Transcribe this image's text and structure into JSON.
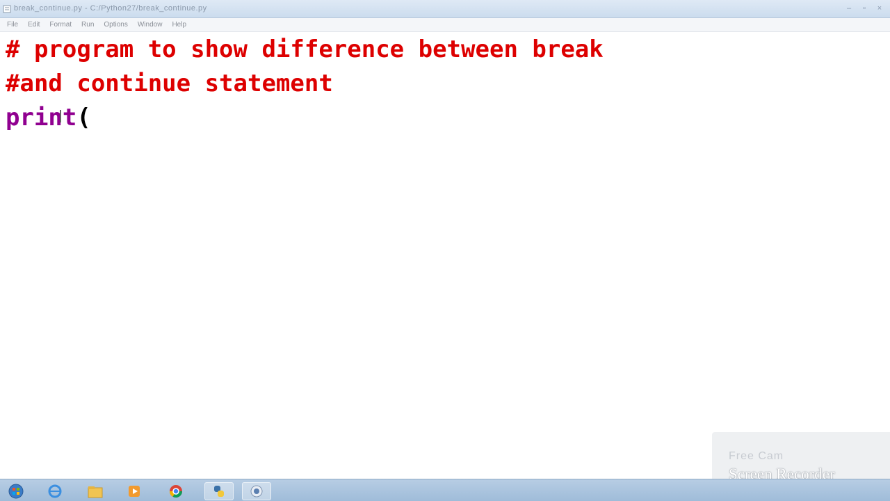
{
  "window": {
    "title": "break_continue.py - C:/Python27/break_continue.py"
  },
  "menubar": {
    "items": [
      "File",
      "Edit",
      "Format",
      "Run",
      "Options",
      "Window",
      "Help"
    ]
  },
  "editor": {
    "line1": "# program to show difference between break",
    "line2": "#and continue statement",
    "line3_builtin": "print",
    "line3_rest": "("
  },
  "watermark": {
    "line1": "Free Cam",
    "line2": "Screen Recorder"
  },
  "taskbar": {
    "items": [
      "start-orb-icon",
      "ie-icon",
      "explorer-icon",
      "media-icon",
      "chrome-icon",
      "python-icon",
      "app-icon"
    ]
  },
  "colors": {
    "comment": "#dd0000",
    "builtin": "#900090",
    "titlebar": "#cbdcee",
    "taskbar": "#9fbcd9"
  }
}
